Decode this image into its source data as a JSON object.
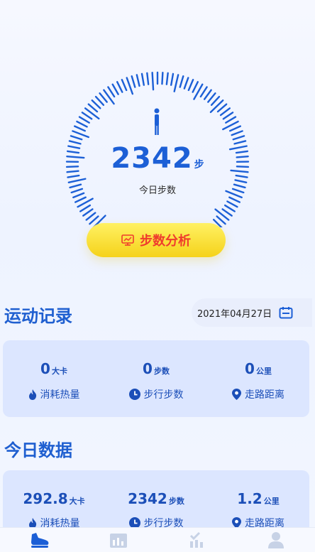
{
  "gauge": {
    "steps": "2342",
    "unit": "步",
    "label": "今日步数",
    "icon": "person-standing-icon",
    "accent": "#1c5fd6",
    "progress": 0.0
  },
  "analysis": {
    "label": "步数分析",
    "icon": "monitor-chart-icon"
  },
  "exercise_record": {
    "title": "运动记录",
    "date": "2021年04月27日",
    "metrics": [
      {
        "value": "0",
        "unit": "大卡",
        "label": "消耗热量",
        "icon": "flame-icon"
      },
      {
        "value": "0",
        "unit": "步数",
        "label": "步行步数",
        "icon": "clock-icon"
      },
      {
        "value": "0",
        "unit": "公里",
        "label": "走路距离",
        "icon": "location-pin-icon"
      }
    ]
  },
  "today_data": {
    "title": "今日数据",
    "metrics": [
      {
        "value": "292.8",
        "unit": "大卡",
        "label": "消耗热量",
        "icon": "flame-icon"
      },
      {
        "value": "2342",
        "unit": "步数",
        "label": "步行步数",
        "icon": "clock-icon"
      },
      {
        "value": "1.2",
        "unit": "公里",
        "label": "走路距离",
        "icon": "location-pin-icon"
      }
    ]
  },
  "tabbar": {
    "tabs": [
      {
        "icon": "shoe-icon",
        "active": true
      },
      {
        "icon": "calendar-chart-icon",
        "active": false
      },
      {
        "icon": "checklist-chart-icon",
        "active": false
      },
      {
        "icon": "user-icon",
        "active": false
      }
    ]
  }
}
